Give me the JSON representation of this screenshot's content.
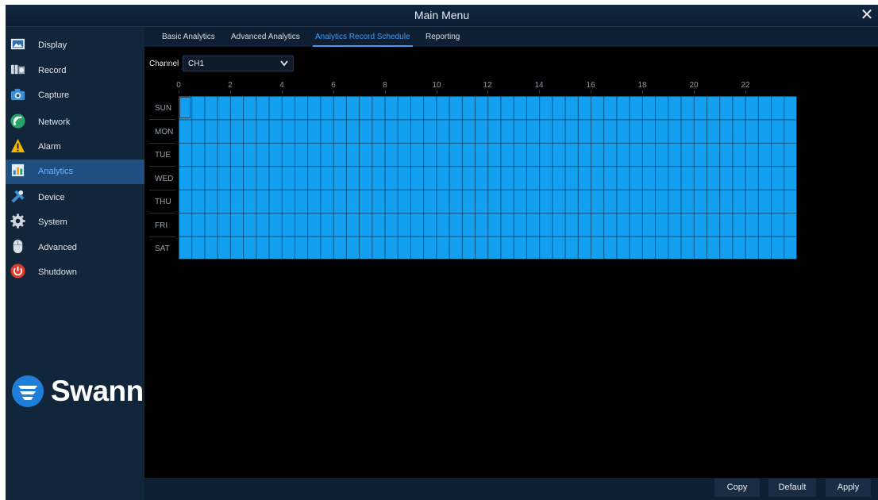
{
  "window": {
    "title": "Main Menu",
    "close_glyph": "✕"
  },
  "sidebar": {
    "items": [
      {
        "label": "Display",
        "icon": "display-icon"
      },
      {
        "label": "Record",
        "icon": "record-icon"
      },
      {
        "label": "Capture",
        "icon": "camera-icon"
      },
      {
        "label": "Network",
        "icon": "network-icon"
      },
      {
        "label": "Alarm",
        "icon": "alarm-icon"
      },
      {
        "label": "Analytics",
        "icon": "analytics-icon",
        "active": true
      },
      {
        "label": "Device",
        "icon": "device-icon"
      },
      {
        "label": "System",
        "icon": "gear-icon"
      },
      {
        "label": "Advanced",
        "icon": "mouse-icon"
      },
      {
        "label": "Shutdown",
        "icon": "power-icon"
      }
    ]
  },
  "logo": {
    "text": "Swann"
  },
  "tabs": [
    {
      "label": "Basic Analytics"
    },
    {
      "label": "Advanced Analytics"
    },
    {
      "label": "Analytics Record Schedule",
      "active": true
    },
    {
      "label": "Reporting"
    }
  ],
  "channel": {
    "label": "Channel",
    "value": "CH1"
  },
  "schedule": {
    "hour_labels": [
      "0",
      "2",
      "4",
      "6",
      "8",
      "10",
      "12",
      "14",
      "16",
      "18",
      "20",
      "22"
    ],
    "days": [
      "SUN",
      "MON",
      "TUE",
      "WED",
      "THU",
      "FRI",
      "SAT"
    ],
    "all_scheduled": true,
    "fill_color": "#13a0f0"
  },
  "footer": {
    "copy_label": "Copy",
    "default_label": "Default",
    "apply_label": "Apply"
  },
  "colors": {
    "accent": "#3f9cf0",
    "sidebar_bg": "#12263b",
    "active_item_bg": "#1e4f80"
  }
}
